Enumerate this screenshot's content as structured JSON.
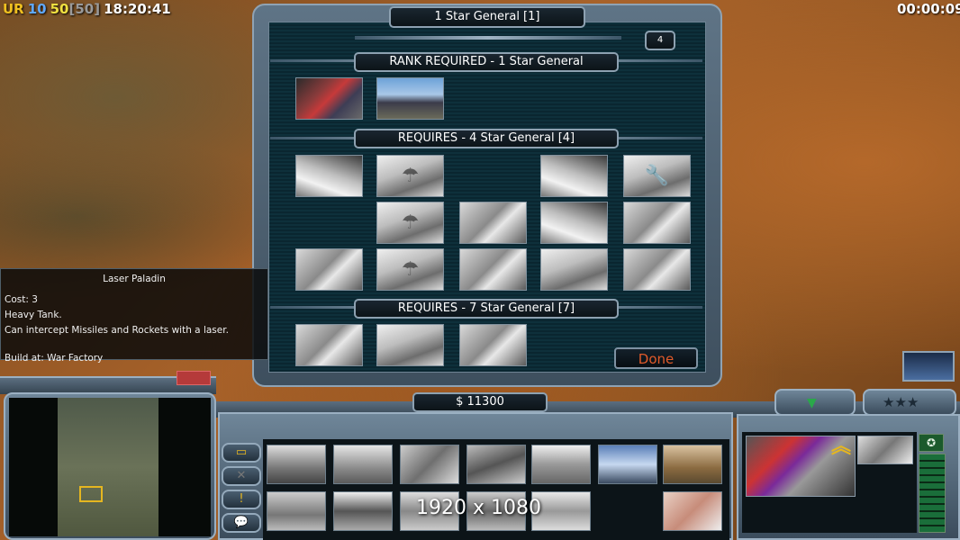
{
  "hud": {
    "tag_ur": "UR",
    "val_10": "10",
    "val_50": "50",
    "val_50_bracket": "[50]",
    "clock": "18:20:41",
    "timer": "00:00:09"
  },
  "general_panel": {
    "title": "1 Star General [1]",
    "points": "4",
    "rank_required_header": "RANK REQUIRED - 1 Star General",
    "requires_4_header": "REQUIRES - 4 Star General [4]",
    "requires_7_header": "REQUIRES - 7 Star General [7]",
    "done_label": "Done"
  },
  "tooltip": {
    "title": "Laser Paladin",
    "cost": "Cost: 3",
    "line1": "Heavy Tank.",
    "line2": "Can intercept Missiles and Rockets with a laser.",
    "build_at": "Build at: War Factory"
  },
  "money": "$ 11300",
  "watermark": "1920 x 1080",
  "colors": {
    "hud_ur": "#f0c020",
    "hud_10": "#60a8ff",
    "hud_50": "#f0e040",
    "hud_50_bracket": "#9a9a9a",
    "done_text": "#e05a2a",
    "rank_chevron": "#e5b620"
  }
}
